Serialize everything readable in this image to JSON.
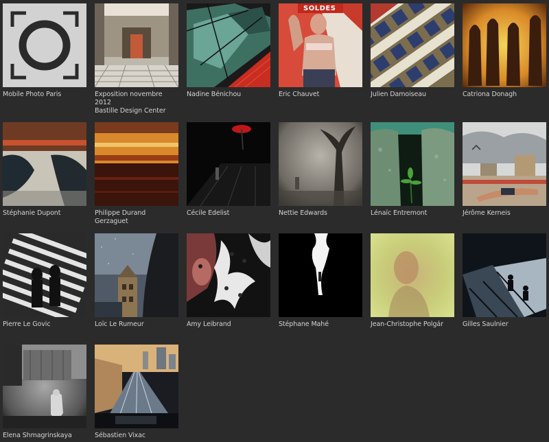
{
  "gallery": {
    "items": [
      {
        "name": "Mobile Photo Paris"
      },
      {
        "name": "Exposition novembre 2012",
        "subtitle": "Bastille Design Center"
      },
      {
        "name": "Nadine Bénichou"
      },
      {
        "name": "Eric Chauvet",
        "sign": "SOLDES"
      },
      {
        "name": "Julien Damoiseau"
      },
      {
        "name": "Catriona Donagh"
      },
      {
        "name": "Stéphanie Dupont"
      },
      {
        "name": "Philippe Durand Gerzaguet"
      },
      {
        "name": "Cécile Edelist"
      },
      {
        "name": "Nettie Edwards"
      },
      {
        "name": "Lénaïc Entremont"
      },
      {
        "name": "Jérôme Kerneis"
      },
      {
        "name": "Pierre Le Govic"
      },
      {
        "name": "Loïc Le Rumeur"
      },
      {
        "name": "Amy Leibrand"
      },
      {
        "name": "Stéphane Mahé"
      },
      {
        "name": "Jean-Christophe Polgár"
      },
      {
        "name": "Gilles Saulnier"
      },
      {
        "name": "Elena Shmagrinskaya"
      },
      {
        "name": "Sébastien Vixac"
      }
    ]
  }
}
